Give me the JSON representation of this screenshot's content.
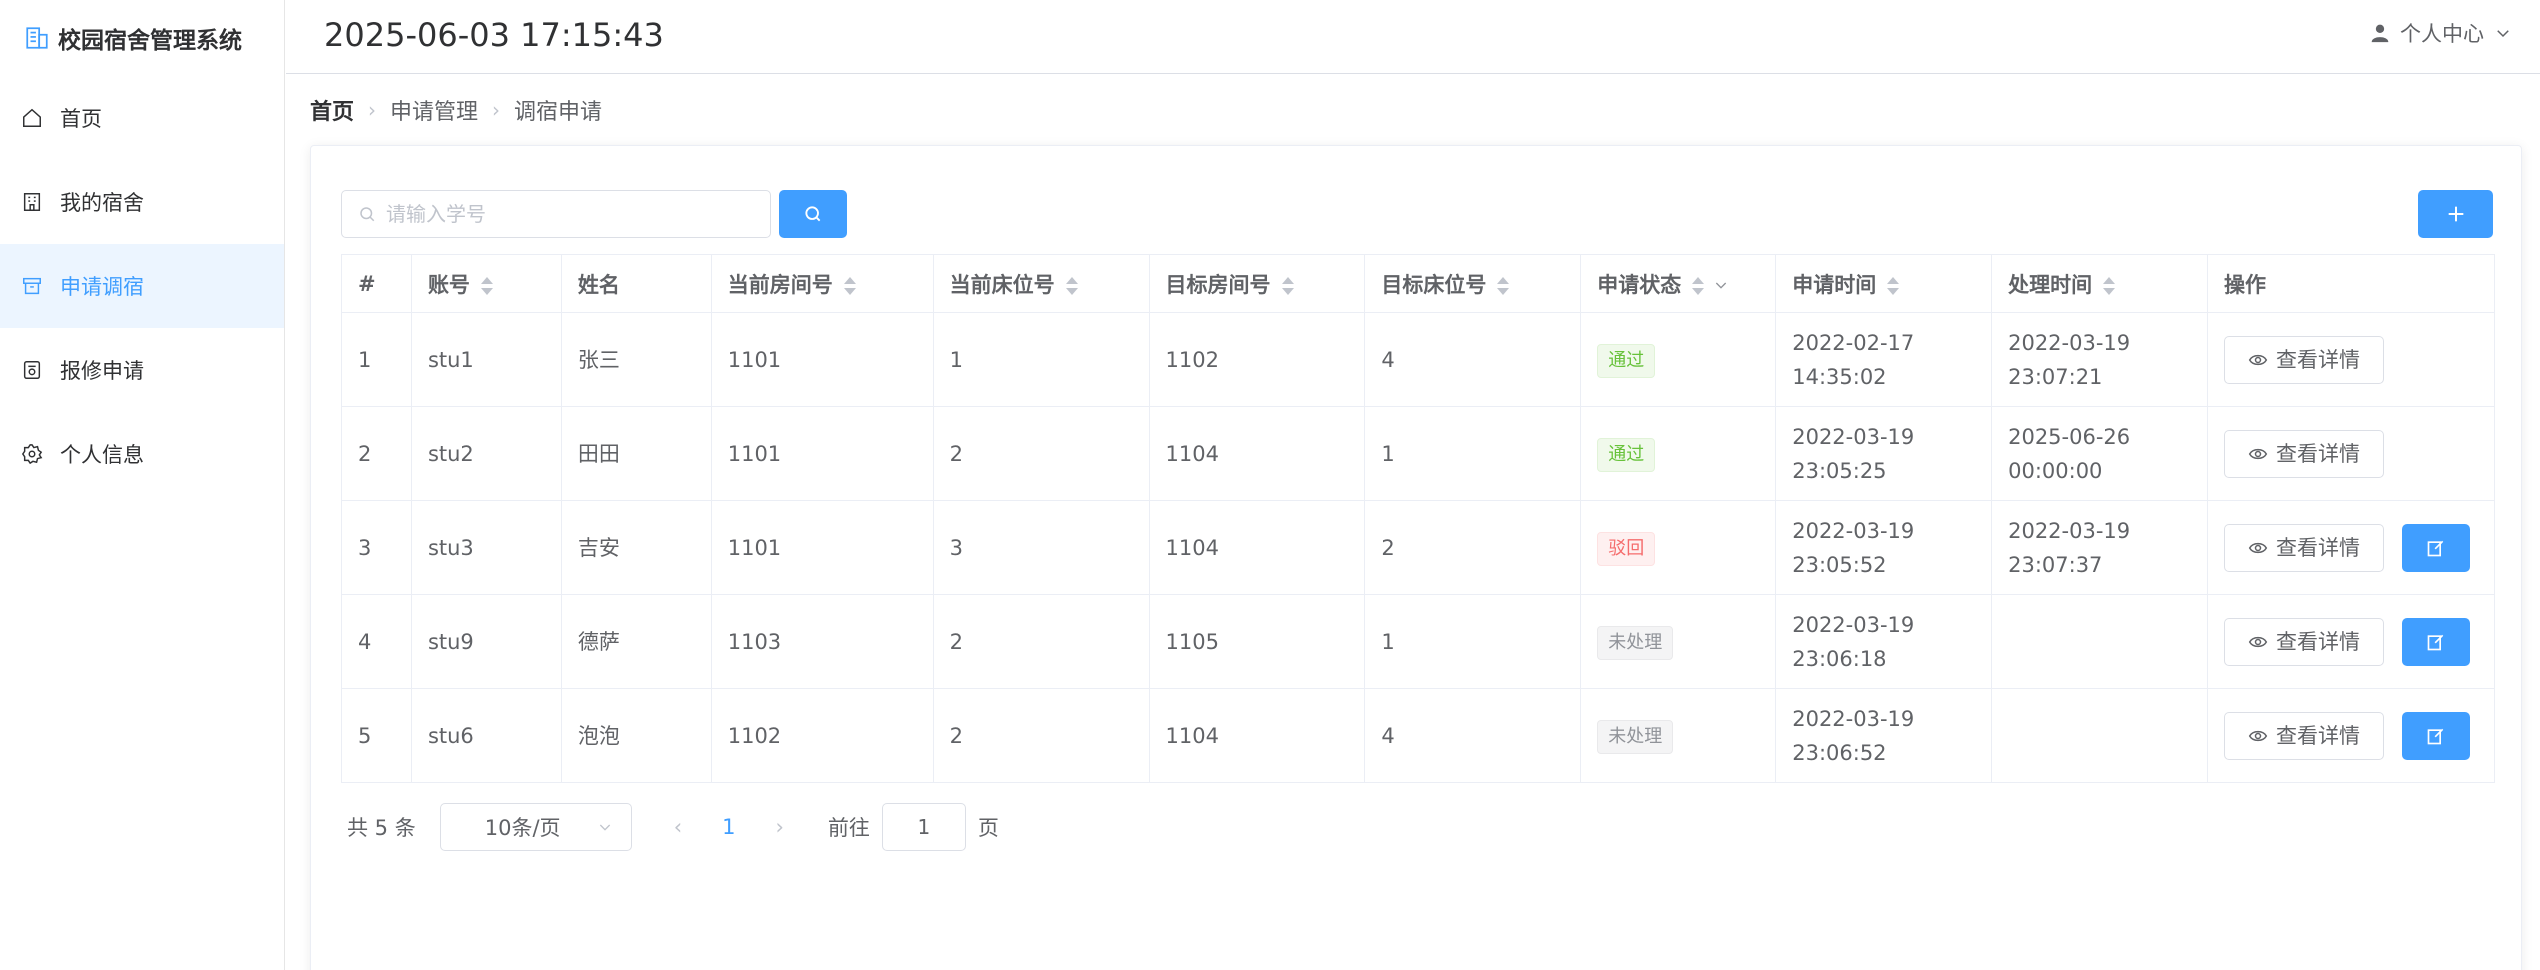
{
  "app": {
    "title": "校园宿舍管理系统"
  },
  "header": {
    "datetime": "2025-06-03 17:15:43",
    "user_center": "个人中心"
  },
  "sidebar": {
    "items": [
      {
        "label": "首页",
        "icon": "home-icon",
        "active": false
      },
      {
        "label": "我的宿舍",
        "icon": "building-icon",
        "active": false
      },
      {
        "label": "申请调宿",
        "icon": "box-icon",
        "active": true
      },
      {
        "label": "报修申请",
        "icon": "repair-icon",
        "active": false
      },
      {
        "label": "个人信息",
        "icon": "gear-icon",
        "active": false
      }
    ]
  },
  "breadcrumb": [
    "首页",
    "申请管理",
    "调宿申请"
  ],
  "search": {
    "placeholder": "请输入学号",
    "value": ""
  },
  "table": {
    "columns": [
      "#",
      "账号",
      "姓名",
      "当前房间号",
      "当前床位号",
      "目标房间号",
      "目标床位号",
      "申请状态",
      "申请时间",
      "处理时间",
      "操作"
    ],
    "rows": [
      {
        "index": "1",
        "account": "stu1",
        "name": "张三",
        "cur_room": "1101",
        "cur_bed": "1",
        "target_room": "1102",
        "target_bed": "4",
        "status": "通过",
        "apply_time": "2022-02-17 14:35:02",
        "process_time": "2022-03-19 23:07:21"
      },
      {
        "index": "2",
        "account": "stu2",
        "name": "田田",
        "cur_room": "1101",
        "cur_bed": "2",
        "target_room": "1104",
        "target_bed": "1",
        "status": "通过",
        "apply_time": "2022-03-19 23:05:25",
        "process_time": "2025-06-26 00:00:00"
      },
      {
        "index": "3",
        "account": "stu3",
        "name": "吉安",
        "cur_room": "1101",
        "cur_bed": "3",
        "target_room": "1104",
        "target_bed": "2",
        "status": "驳回",
        "apply_time": "2022-03-19 23:05:52",
        "process_time": "2022-03-19 23:07:37"
      },
      {
        "index": "4",
        "account": "stu9",
        "name": "德萨",
        "cur_room": "1103",
        "cur_bed": "2",
        "target_room": "1105",
        "target_bed": "1",
        "status": "未处理",
        "apply_time": "2022-03-19 23:06:18",
        "process_time": ""
      },
      {
        "index": "5",
        "account": "stu6",
        "name": "泡泡",
        "cur_room": "1102",
        "cur_bed": "2",
        "target_room": "1104",
        "target_bed": "4",
        "status": "未处理",
        "apply_time": "2022-03-19 23:06:52",
        "process_time": ""
      }
    ],
    "detail_label": "查看详情"
  },
  "pagination": {
    "total_label": "共 5 条",
    "page_size": "10条/页",
    "current_page": "1",
    "goto_label": "前往",
    "goto_value": "1",
    "page_unit": "页"
  },
  "colors": {
    "primary": "#409eff",
    "success": "#67c23a",
    "danger": "#f56c6c",
    "info": "#909399",
    "active_bg": "#ecf5ff"
  }
}
